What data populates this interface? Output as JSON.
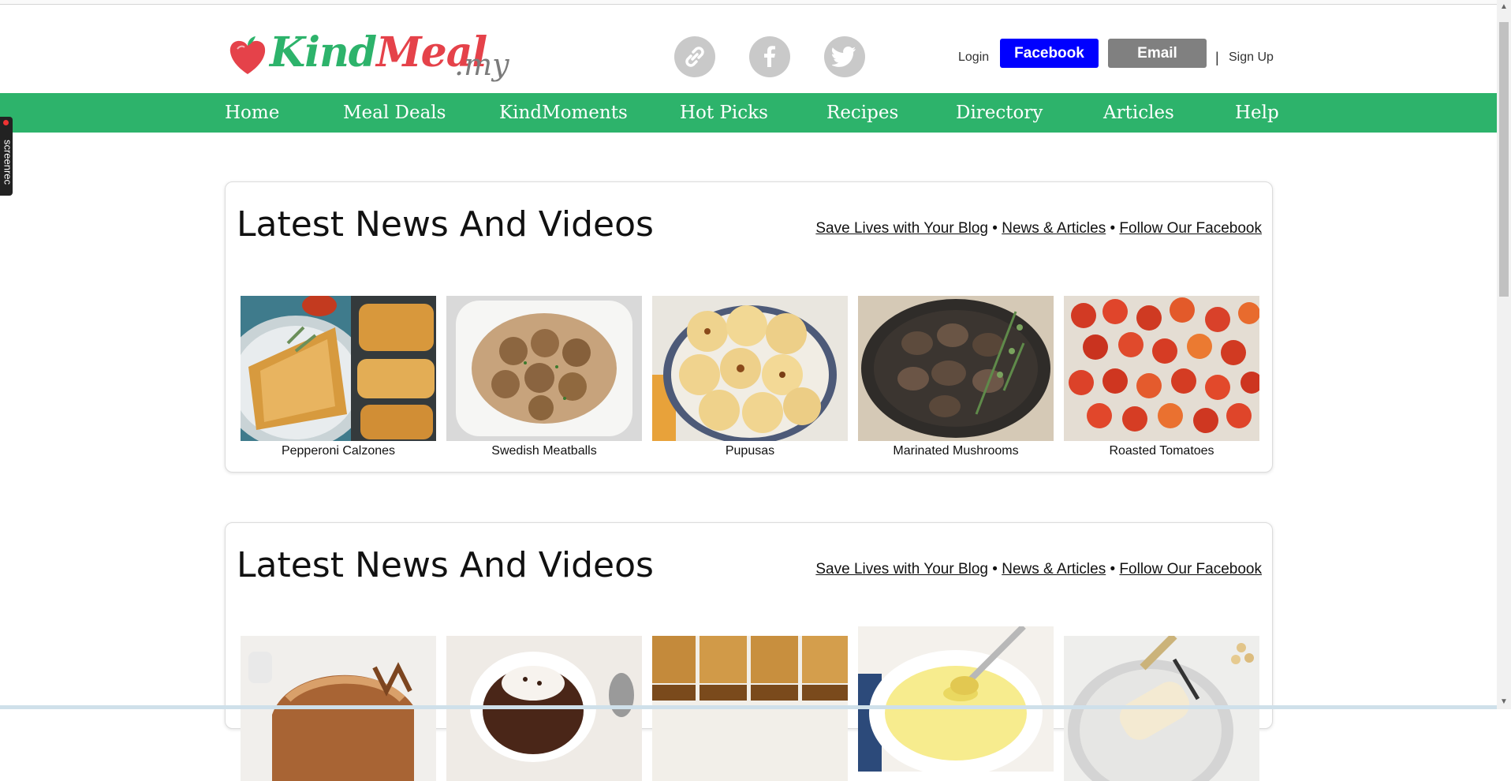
{
  "header": {
    "logo_main": "KindMeal",
    "logo_kind": "Kind",
    "logo_meal": "Meal",
    "logo_suffix": ".my",
    "login_label": "Login",
    "facebook_label": "Facebook",
    "email_label": "Email",
    "separator": "|",
    "signup_label": "Sign Up"
  },
  "nav": {
    "items": [
      "Home",
      "Meal Deals",
      "KindMoments",
      "Hot Picks",
      "Recipes",
      "Directory",
      "Articles",
      "Help"
    ]
  },
  "screenrec": "screenrec",
  "sections": [
    {
      "title": "Latest News And Videos",
      "link1": "Save Lives with Your Blog",
      "link2": "News & Articles",
      "link3": "Follow Our Facebook",
      "bullet": "•",
      "items": [
        {
          "caption": "Pepperoni Calzones"
        },
        {
          "caption": "Swedish Meatballs"
        },
        {
          "caption": "Pupusas"
        },
        {
          "caption": "Marinated Mushrooms"
        },
        {
          "caption": "Roasted Tomatoes"
        }
      ]
    },
    {
      "title": "Latest News And Videos",
      "link1": "Save Lives with Your Blog",
      "link2": "News & Articles",
      "link3": "Follow Our Facebook",
      "bullet": "•"
    }
  ],
  "colors": {
    "brand_green": "#2db36b",
    "brand_red": "#e5424a",
    "facebook_blue": "#0000ff",
    "email_gray": "#808080"
  }
}
